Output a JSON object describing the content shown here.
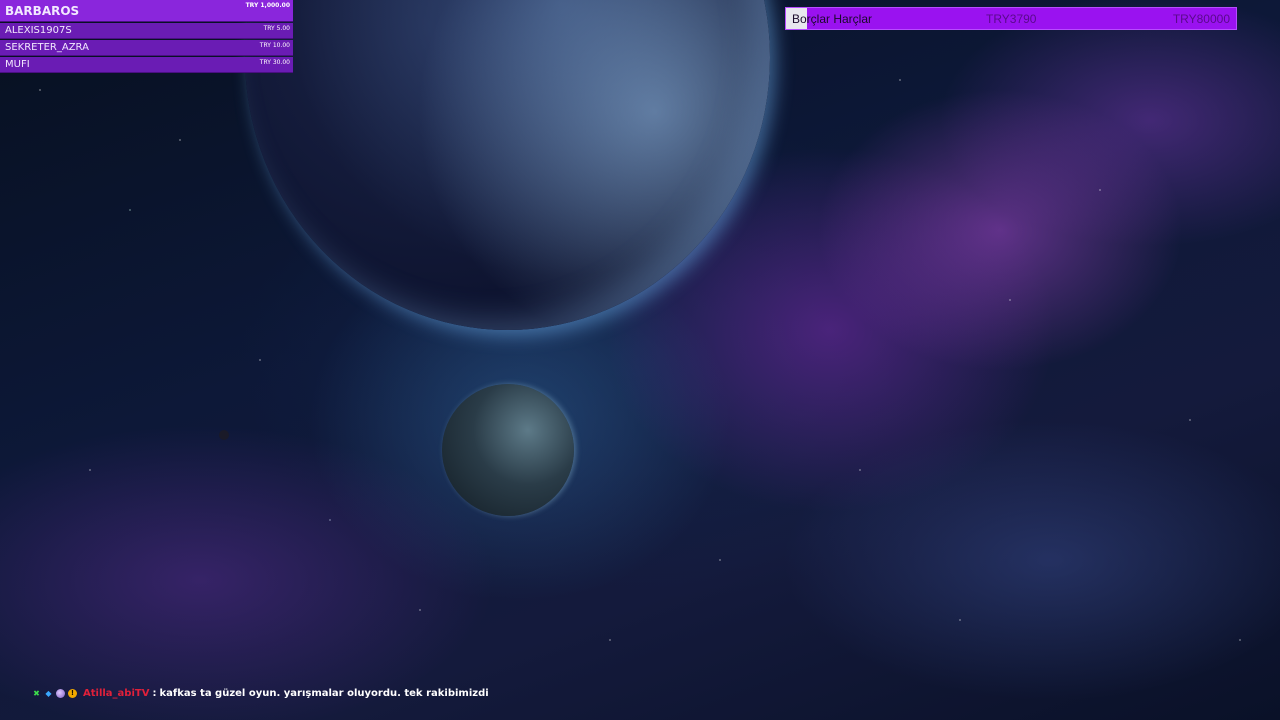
{
  "leaderboard": {
    "top": {
      "name": "BARBAROS",
      "amount": "TRY 1,000.00"
    },
    "rows": [
      {
        "name": "ALEXIS1907S",
        "amount": "TRY 5.00"
      },
      {
        "name": "SEKRETER_AZRA",
        "amount": "TRY 10.00"
      },
      {
        "name": "MUFI",
        "amount": "TRY 30.00"
      }
    ]
  },
  "goal": {
    "title": "Borçlar Harçlar",
    "current": "TRY3790",
    "target": "TRY80000",
    "progress_fraction": 0.047,
    "colors": {
      "bar": "#9a12f0",
      "fill": "#e8e6ee"
    }
  },
  "chat": {
    "badges": [
      "moderator-sword-icon",
      "cube-badge-icon",
      "orb-badge-icon",
      "bits-badge-icon"
    ],
    "username": "Atilla_abiTV",
    "separator": ":",
    "message": "kafkas ta güzel oyun. yarışmalar oluyordu. tek rakibimizdi",
    "colors": {
      "username": "#e0203a",
      "message": "#ffffff"
    }
  }
}
